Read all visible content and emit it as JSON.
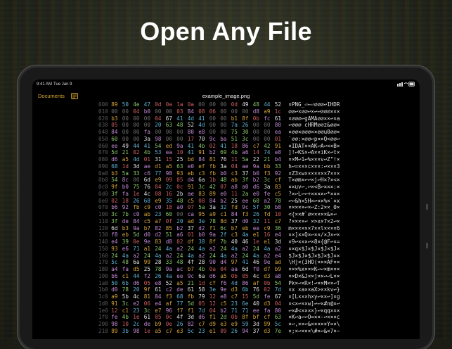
{
  "headline": "Open Any File",
  "status": {
    "time": "9:41 AM",
    "date": "Tue Jan 9"
  },
  "nav": {
    "documents_label": "Documents",
    "file_title": "example_image.png"
  },
  "hex_rows": [
    {
      "off": "000",
      "bytes": [
        "89",
        "50",
        "4e",
        "47",
        "0d",
        "0a",
        "1a",
        "0a",
        "00",
        "00",
        "00",
        "0d",
        "49",
        "48",
        "44",
        "52"
      ],
      "ascii": "×PNG_⏎←⏎∅∅∅↩IHDR"
    },
    {
      "off": "010",
      "bytes": [
        "00",
        "00",
        "04",
        "b0",
        "00",
        "00",
        "03",
        "84",
        "08",
        "06",
        "00",
        "00",
        "00",
        "d8",
        "a9",
        "1c"
      ],
      "ascii": "∅∅↩×∅∅↩×↩↩∅∅∅×××"
    },
    {
      "off": "020",
      "bytes": [
        "b3",
        "00",
        "00",
        "00",
        "04",
        "67",
        "41",
        "4d",
        "41",
        "00",
        "00",
        "b1",
        "8f",
        "0b",
        "fc",
        "61"
      ],
      "ascii": "×∅∅∅↩gAMA∅∅××↩×a"
    },
    {
      "off": "030",
      "bytes": [
        "05",
        "00",
        "00",
        "00",
        "20",
        "63",
        "48",
        "52",
        "4d",
        "00",
        "00",
        "7a",
        "26",
        "00",
        "00",
        "80"
      ],
      "ascii": "↩∅∅∅ cHRM∅∅z&∅∅×"
    },
    {
      "off": "040",
      "bytes": [
        "84",
        "00",
        "00",
        "fa",
        "00",
        "00",
        "00",
        "80",
        "e8",
        "00",
        "00",
        "75",
        "30",
        "00",
        "00",
        "ea"
      ],
      "ascii": "×∅∅×∅∅∅××∅∅u0∅∅×"
    },
    {
      "off": "050",
      "bytes": [
        "60",
        "00",
        "00",
        "3a",
        "98",
        "00",
        "00",
        "17",
        "70",
        "9c",
        "ba",
        "51",
        "3c",
        "00",
        "00",
        "01"
      ],
      "ascii": "`∅∅:×∅∅↩p××Q<∅∅↩"
    },
    {
      "off": "060",
      "bytes": [
        "ee",
        "49",
        "44",
        "41",
        "54",
        "ed",
        "9a",
        "41",
        "4b",
        "02",
        "41",
        "18",
        "86",
        "c7",
        "42",
        "91"
      ],
      "ascii": "×IDAT××AK↩A↩××B×"
    },
    {
      "off": "070",
      "bytes": [
        "5d",
        "21",
        "02",
        "4b",
        "53",
        "ea",
        "10",
        "41",
        "91",
        "b2",
        "69",
        "4b",
        "a6",
        "14",
        "74",
        "e8"
      ],
      "ascii": "]!↩KS×↩A××iK×↩t×"
    },
    {
      "off": "080",
      "bytes": [
        "d6",
        "a5",
        "4d",
        "01",
        "31",
        "15",
        "25",
        "bd",
        "84",
        "81",
        "76",
        "11",
        "5a",
        "22",
        "21",
        "b4"
      ],
      "ascii": "××M↩1↩%×××v↩Z\"!×"
    },
    {
      "off": "090",
      "bytes": [
        "68",
        "1d",
        "3d",
        "ae",
        "d1",
        "a5",
        "63",
        "e0",
        "ef",
        "fb",
        "3a",
        "04",
        "ae",
        "9a",
        "bb",
        "33"
      ],
      "ascii": "h↩=×××c×××:↩×××3"
    },
    {
      "off": "0a0",
      "bytes": [
        "b3",
        "5a",
        "33",
        "c6",
        "77",
        "98",
        "93",
        "eb",
        "c3",
        "fb",
        "b0",
        "c3",
        "37",
        "b0",
        "f3",
        "92"
      ],
      "ascii": "×Z3×w×××××××7×××"
    },
    {
      "off": "0b0",
      "bytes": [
        "54",
        "8c",
        "00",
        "6d",
        "e9",
        "09",
        "05",
        "d4",
        "6a",
        "1b",
        "48",
        "ab",
        "3f",
        "b2",
        "3c",
        "cf"
      ],
      "ascii": "T×∅m×↩↩×j↩H×?×<×"
    },
    {
      "off": "0c0",
      "bytes": [
        "9f",
        "b0",
        "75",
        "76",
        "04",
        "2c",
        "0c",
        "91",
        "3c",
        "42",
        "07",
        "a8",
        "a0",
        "d6",
        "3a",
        "83"
      ],
      "ascii": "××uv↩,↩×<B↩×××:×"
    },
    {
      "off": "0d0",
      "bytes": [
        "3f",
        "fa",
        "1e",
        "4c",
        "08",
        "16",
        "2b",
        "ae",
        "83",
        "89",
        "e0",
        "11",
        "2a",
        "e0",
        "fe",
        "c5"
      ],
      "ascii": "?×↩L↩↩+××××↩*×××"
    },
    {
      "off": "0e0",
      "bytes": [
        "02",
        "18",
        "26",
        "68",
        "e9",
        "35",
        "48",
        "c5",
        "08",
        "84",
        "b2",
        "25",
        "ee",
        "60",
        "a2",
        "78"
      ],
      "ascii": "↩↩&h×5H×↩××%×`×x"
    },
    {
      "off": "0f0",
      "bytes": [
        "b6",
        "92",
        "fb",
        "c9",
        "c0",
        "18",
        "a0",
        "07",
        "5a",
        "3a",
        "32",
        "fd",
        "9c",
        "5f",
        "30",
        "b8"
      ],
      "ascii": "×××××↩×↩Z:2××_0×"
    },
    {
      "off": "100",
      "bytes": [
        "3c",
        "7b",
        "c0",
        "ab",
        "23",
        "60",
        "00",
        "ca",
        "95",
        "a9",
        "c1",
        "84",
        "f3",
        "26",
        "fd",
        "10"
      ],
      "ascii": "<{××#`∅×××××&×↩"
    },
    {
      "off": "110",
      "bytes": [
        "3f",
        "de",
        "84",
        "c5",
        "a7",
        "0f",
        "20",
        "ad",
        "3e",
        "78",
        "8d",
        "37",
        "d0",
        "32",
        "11",
        "c7"
      ],
      "ascii": "?××××↩ ×>x×7×2↩×"
    },
    {
      "off": "120",
      "bytes": [
        "6d",
        "b3",
        "9a",
        "b7",
        "82",
        "85",
        "b2",
        "37",
        "d2",
        "f1",
        "6c",
        "b7",
        "eb",
        "ee",
        "c9",
        "36"
      ],
      "ascii": "m××××××7××l××××6"
    },
    {
      "off": "130",
      "bytes": [
        "f8",
        "eb",
        "5d",
        "d0",
        "d2",
        "51",
        "a6",
        "01",
        "b0",
        "9a",
        "2f",
        "c3",
        "4a",
        "e1",
        "16",
        "e4"
      ],
      "ascii": "××]××Q×↩××/×J×↩×"
    },
    {
      "off": "140",
      "bytes": [
        "e4",
        "39",
        "0e",
        "9e",
        "83",
        "d8",
        "02",
        "df",
        "38",
        "8f",
        "7b",
        "40",
        "46",
        "1e",
        "e1",
        "3d"
      ],
      "ascii": "×9↩×××↩×8×{@F↩×="
    },
    {
      "off": "150",
      "bytes": [
        "93",
        "e6",
        "71",
        "a1",
        "24",
        "4a",
        "a2",
        "24",
        "4a",
        "a2",
        "24",
        "4a",
        "a2",
        "24",
        "4a",
        "a2"
      ],
      "ascii": "××q×$J×$J×$J×$J×"
    },
    {
      "off": "160",
      "bytes": [
        "24",
        "4a",
        "a2",
        "24",
        "4a",
        "a2",
        "24",
        "4a",
        "a2",
        "24",
        "4a",
        "a2",
        "24",
        "4a",
        "a2",
        "e4"
      ],
      "ascii": "$J×$J×$J×$J×$J××"
    },
    {
      "off": "170",
      "bytes": [
        "5c",
        "48",
        "6a",
        "99",
        "28",
        "33",
        "48",
        "4f",
        "28",
        "90",
        "d4",
        "97",
        "41",
        "46",
        "9e",
        "ad"
      ],
      "ascii": "\\Hj×(3HO(×××AF××"
    },
    {
      "off": "180",
      "bytes": [
        "a4",
        "fa",
        "d5",
        "25",
        "78",
        "9a",
        "ac",
        "b7",
        "4b",
        "0a",
        "04",
        "aa",
        "6d",
        "f0",
        "d7",
        "b9"
      ],
      "ascii": "×××%x×××K↩↩×m×××"
    },
    {
      "off": "190",
      "bytes": [
        "b6",
        "c1",
        "44",
        "f2",
        "26",
        "4a",
        "ee",
        "9c",
        "6a",
        "d6",
        "a5",
        "0b",
        "05",
        "4c",
        "d3",
        "a8"
      ],
      "ascii": "××D×&J××j××↩↩L××"
    },
    {
      "off": "1a0",
      "bytes": [
        "50",
        "6b",
        "d6",
        "05",
        "e8",
        "52",
        "a5",
        "21",
        "1d",
        "cf",
        "f6",
        "4d",
        "86",
        "af",
        "0b",
        "54"
      ],
      "ascii": "Pk×↩×R×!↩××M××↩T"
    },
    {
      "off": "1b0",
      "bytes": [
        "d0",
        "78",
        "20",
        "9f",
        "61",
        "c2",
        "de",
        "61",
        "58",
        "3e",
        "9e",
        "d3",
        "6b",
        "76",
        "02",
        "7d"
      ],
      "ascii": "×x ×a××aX>××kv↩}"
    },
    {
      "off": "1c0",
      "bytes": [
        "a9",
        "5b",
        "4c",
        "81",
        "84",
        "f3",
        "68",
        "fb",
        "79",
        "12",
        "e8",
        "c7",
        "15",
        "5d",
        "fe",
        "67"
      ],
      "ascii": "×[L×××h×y↩××↩]×g"
    },
    {
      "off": "1d0",
      "bytes": [
        "91",
        "3c",
        "e2",
        "06",
        "e4",
        "af",
        "77",
        "5d",
        "05",
        "12",
        "c5",
        "23",
        "6e",
        "40",
        "d3",
        "04"
      ],
      "ascii": "×<×↩××w]↩↩×#n@×↩"
    },
    {
      "off": "1e0",
      "bytes": [
        "12",
        "c1",
        "23",
        "3c",
        "e7",
        "96",
        "f7",
        "f1",
        "7d",
        "04",
        "b2",
        "71",
        "71",
        "ee",
        "fa",
        "80"
      ],
      "ascii": "↩×#<××××}↩×qq×××"
    },
    {
      "off": "1f0",
      "bytes": [
        "fe",
        "4b",
        "1e",
        "61",
        "05",
        "0c",
        "4f",
        "3d",
        "d6",
        "f1",
        "2d",
        "0b",
        "8f",
        "bf",
        "cf",
        "63"
      ],
      "ascii": "×K↩a↩↩O=××-↩×××c"
    },
    {
      "off": "200",
      "bytes": [
        "98",
        "10",
        "2c",
        "de",
        "b9",
        "0e",
        "26",
        "82",
        "c7",
        "d9",
        "e3",
        "e9",
        "59",
        "3d",
        "99",
        "5c"
      ],
      "ascii": "×↩,××↩&×××××Y=×\\"
    },
    {
      "off": "210",
      "bytes": [
        "89",
        "3b",
        "98",
        "1e",
        "a5",
        "c7",
        "e3",
        "5c",
        "23",
        "e1",
        "09",
        "26",
        "94",
        "37",
        "d3",
        "7e"
      ],
      "ascii": "×;×↩×××\\#×↩&×7×~"
    }
  ]
}
